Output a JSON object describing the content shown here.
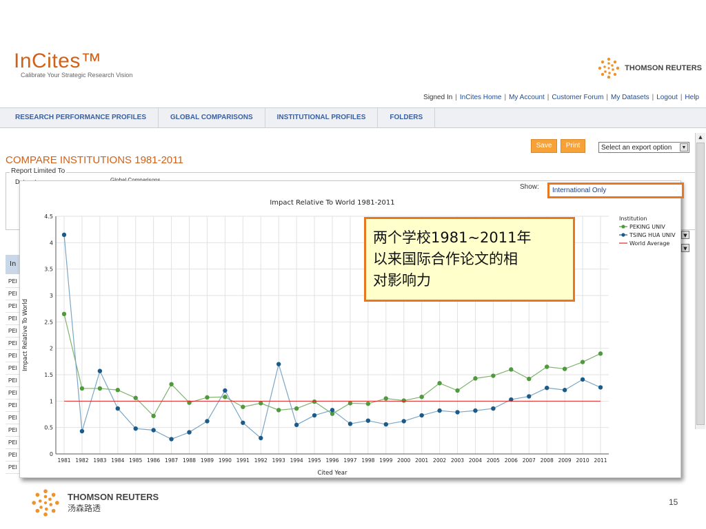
{
  "header": {
    "logo": "InCites™",
    "tagline": "Calibrate Your Strategic Research Vision",
    "brand": "THOMSON REUTERS",
    "links": [
      "Signed In",
      "InCites Home",
      "My Account",
      "Customer Forum",
      "My Datasets",
      "Logout",
      "Help"
    ]
  },
  "nav": {
    "tabs": [
      "RESEARCH PERFORMANCE PROFILES",
      "GLOBAL COMPARISONS",
      "INSTITUTIONAL PROFILES",
      "FOLDERS"
    ]
  },
  "page": {
    "title": "COMPARE INSTITUTIONS 1981-2011",
    "report_legend": "Report Limited To",
    "dataset_label": "Dataset:",
    "dataset_value": "Global Comparisons",
    "save_label": "Save",
    "print_label": "Print",
    "export_select": "Select an export option",
    "show_label": "Show:",
    "show_value": "International Only",
    "table_header": "In",
    "table_rows": [
      "PEI",
      "PEI",
      "PEI",
      "PEI",
      "PEI",
      "PEI",
      "PEI",
      "PEI",
      "PEI",
      "PEI",
      "PEI",
      "PEI",
      "PEI",
      "PEI",
      "PEI",
      "PEI"
    ]
  },
  "annotation": {
    "lines": [
      "两个学校1981~2011年",
      "以来国际合作论文的相",
      "对影响力"
    ]
  },
  "footer": {
    "brand": "THOMSON REUTERS",
    "brand_cn": "汤森路透",
    "page_number": "15"
  },
  "colors": {
    "accent": "#e87722",
    "peking": "#4e9a3c",
    "tsinghua": "#1b5b8a",
    "world": "#e02020"
  },
  "chart_data": {
    "type": "line",
    "title": "Impact Relative To World 1981-2011",
    "xlabel": "Cited Year",
    "ylabel": "Impact Relative To World",
    "ylim": [
      0,
      4.5
    ],
    "yticks": [
      "0",
      "0.5",
      "1",
      "1.5",
      "2",
      "2.5",
      "3",
      "3.5",
      "4",
      "4.5"
    ],
    "categories": [
      "1981",
      "1982",
      "1983",
      "1984",
      "1985",
      "1986",
      "1987",
      "1988",
      "1989",
      "1990",
      "1991",
      "1992",
      "1993",
      "1994",
      "1995",
      "1996",
      "1997",
      "1998",
      "1999",
      "2000",
      "2001",
      "2002",
      "2003",
      "2004",
      "2005",
      "2006",
      "2007",
      "2008",
      "2009",
      "2010",
      "2011"
    ],
    "legend_title": "Institution",
    "legend_position": "right",
    "series": [
      {
        "name": "PEKING UNIV",
        "color": "#4e9a3c",
        "values": [
          2.65,
          1.24,
          1.24,
          1.21,
          1.06,
          0.72,
          1.32,
          0.97,
          1.07,
          1.08,
          0.89,
          0.96,
          0.83,
          0.86,
          0.99,
          0.76,
          0.96,
          0.95,
          1.05,
          1.01,
          1.08,
          1.34,
          1.2,
          1.43,
          1.48,
          1.6,
          1.42,
          1.65,
          1.61,
          1.74,
          1.9
        ]
      },
      {
        "name": "TSING HUA UNIV",
        "color": "#1b5b8a",
        "values": [
          4.15,
          0.43,
          1.57,
          0.86,
          0.48,
          0.45,
          0.28,
          0.41,
          0.62,
          1.2,
          0.59,
          0.3,
          1.7,
          0.55,
          0.73,
          0.83,
          0.57,
          0.63,
          0.56,
          0.62,
          0.73,
          0.82,
          0.79,
          0.82,
          0.86,
          1.03,
          1.09,
          1.25,
          1.21,
          1.41,
          1.26
        ]
      },
      {
        "name": "World Average",
        "color": "#e02020",
        "values": [
          1,
          1,
          1,
          1,
          1,
          1,
          1,
          1,
          1,
          1,
          1,
          1,
          1,
          1,
          1,
          1,
          1,
          1,
          1,
          1,
          1,
          1,
          1,
          1,
          1,
          1,
          1,
          1,
          1,
          1,
          1
        ]
      }
    ]
  }
}
